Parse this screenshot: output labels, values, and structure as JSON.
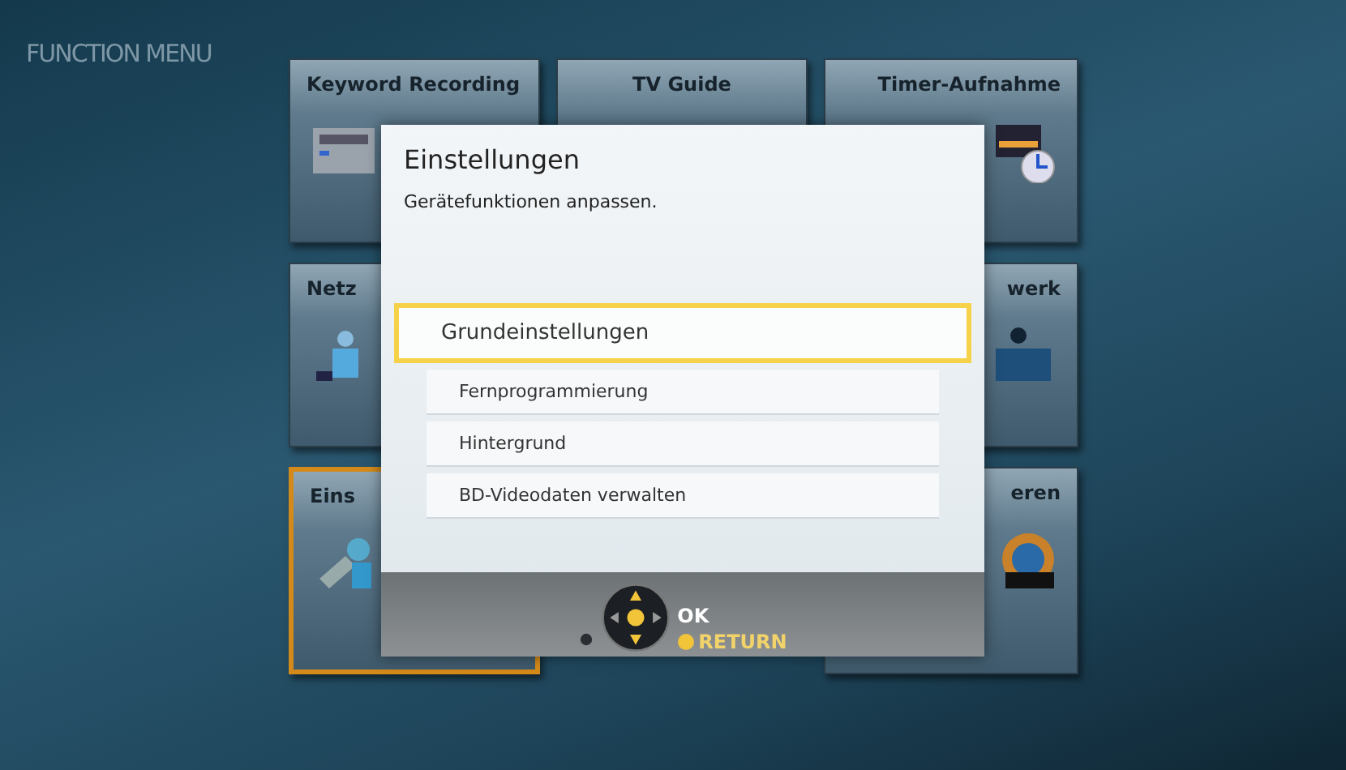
{
  "screen_title": "FUNCTION MENU",
  "tile_rows": [
    {
      "left": {
        "label": "Keyword Recording",
        "selected": false
      },
      "center": {
        "label": "TV Guide",
        "selected": false
      },
      "right": {
        "label": "Timer-Aufnahme",
        "selected": false
      }
    },
    {
      "left": {
        "label": "Netz",
        "selected": false
      },
      "right": {
        "label": "werk",
        "selected": false
      }
    },
    {
      "left": {
        "label": "Eins",
        "selected": true
      },
      "right": {
        "label": "eren",
        "selected": false
      }
    }
  ],
  "dialog": {
    "title": "Einstellungen",
    "description": "Gerätefunktionen anpassen.",
    "options": [
      {
        "label": "Grundeinstellungen",
        "selected": true
      },
      {
        "label": "Fernprogrammierung",
        "selected": false
      },
      {
        "label": "Hintergrund",
        "selected": false
      },
      {
        "label": "BD-Videodaten verwalten",
        "selected": false
      }
    ],
    "hints": {
      "ok": "OK",
      "return": "RETURN"
    }
  }
}
